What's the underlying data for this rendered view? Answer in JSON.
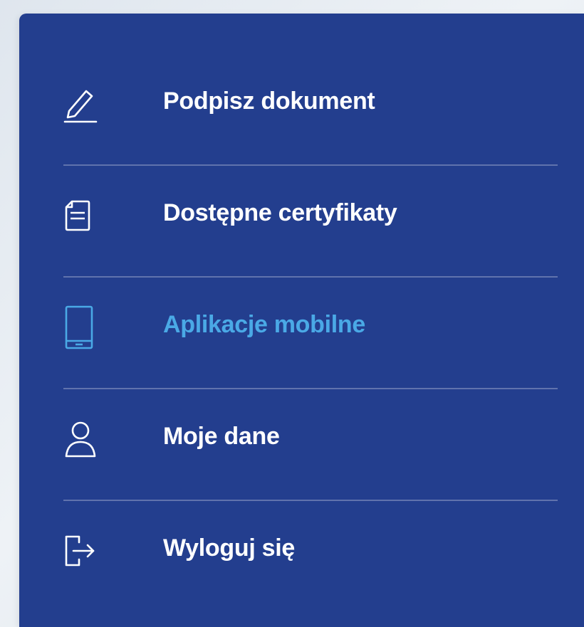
{
  "colors": {
    "panel_background": "#233e8e",
    "text": "#ffffff",
    "active_text": "#4aa9e6",
    "divider": "rgba(255,255,255,0.28)"
  },
  "menu": {
    "items": [
      {
        "label": "Podpisz dokument",
        "icon": "pen-sign-icon",
        "active": false
      },
      {
        "label": "Dostępne certyfikaty",
        "icon": "document-icon",
        "active": false
      },
      {
        "label": "Aplikacje mobilne",
        "icon": "tablet-icon",
        "active": true
      },
      {
        "label": "Moje dane",
        "icon": "user-icon",
        "active": false
      },
      {
        "label": "Wyloguj się",
        "icon": "logout-icon",
        "active": false
      }
    ]
  }
}
